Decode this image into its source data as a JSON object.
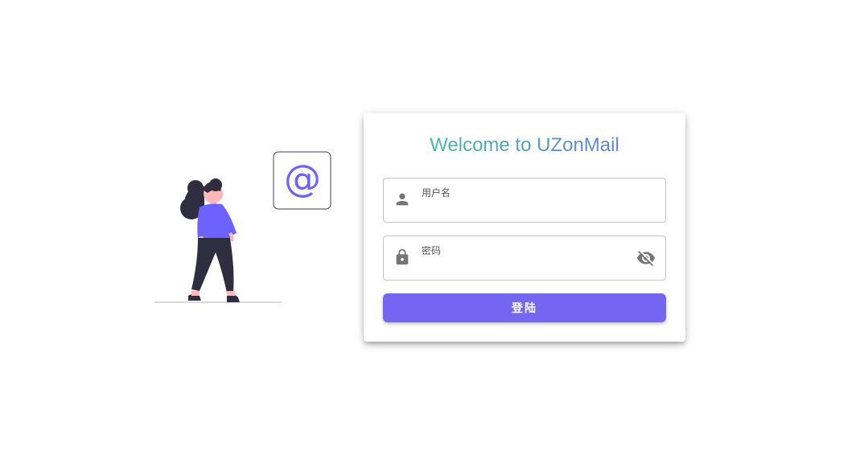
{
  "login": {
    "title": "Welcome to UZonMail",
    "username": {
      "label": "用户名",
      "value": "",
      "icon": "person-icon"
    },
    "password": {
      "label": "密码",
      "value": "",
      "icon": "lock-icon",
      "toggle_icon": "eye-off-icon"
    },
    "submit_label": "登陆"
  },
  "illustration": {
    "badge_symbol": "@",
    "icons": [
      "woman-figure-illustration",
      "at-sign-icon"
    ]
  },
  "colors": {
    "accent": "#7366f0",
    "title_gradient_start": "#3ecf8e",
    "title_gradient_end": "#6f6fe6",
    "icon_gray": "#757575"
  }
}
